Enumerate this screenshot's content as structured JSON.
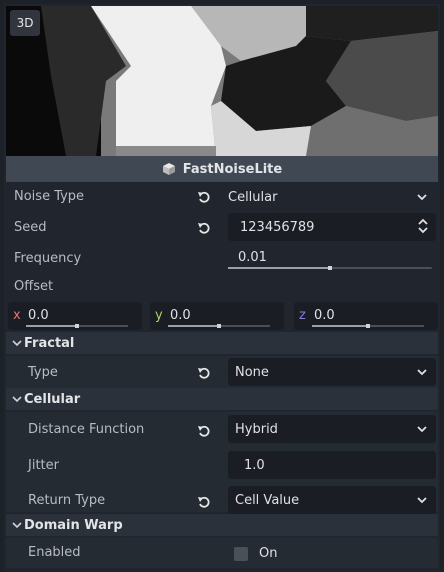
{
  "preview": {
    "badge": "3D"
  },
  "resource": {
    "title": "FastNoiseLite",
    "icon": "cube-icon"
  },
  "properties": {
    "noise_type": {
      "label": "Noise Type",
      "value": "Cellular"
    },
    "seed": {
      "label": "Seed",
      "value": "123456789"
    },
    "frequency": {
      "label": "Frequency",
      "value": "0.01",
      "level": 0.5
    },
    "offset": {
      "label": "Offset",
      "x": {
        "axis": "x",
        "value": "0.0",
        "color": "#e5736f",
        "level": 0.5
      },
      "y": {
        "axis": "y",
        "value": "0.0",
        "color": "#a5d65f",
        "level": 0.5
      },
      "z": {
        "axis": "z",
        "value": "0.0",
        "color": "#8a7bd9",
        "level": 0.5
      }
    }
  },
  "sections": {
    "fractal": {
      "title": "Fractal",
      "type": {
        "label": "Type",
        "value": "None"
      }
    },
    "cellular": {
      "title": "Cellular",
      "distance_function": {
        "label": "Distance Function",
        "value": "Hybrid"
      },
      "jitter": {
        "label": "Jitter",
        "value": "1.0"
      },
      "return_type": {
        "label": "Return Type",
        "value": "Cell Value"
      }
    },
    "domain_warp": {
      "title": "Domain Warp",
      "enabled": {
        "label": "Enabled",
        "value": "On",
        "checked": false
      }
    }
  },
  "colors": {
    "panel_bg": "#21262e",
    "field_bg": "#1a1e24",
    "header_bg": "#404854",
    "section_bg": "#2b313a"
  }
}
